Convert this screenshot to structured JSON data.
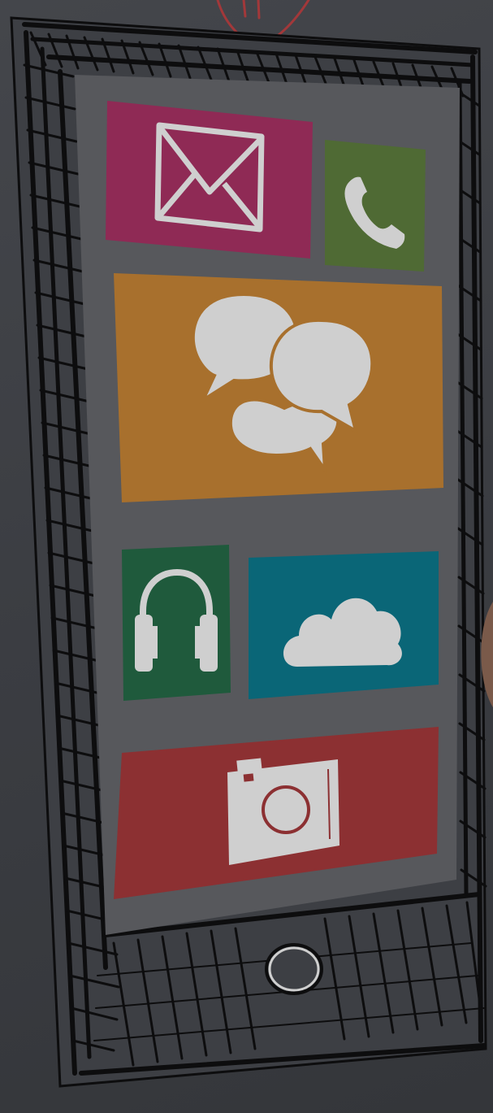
{
  "colors": {
    "background": "#3b3d42",
    "screen": "#57585c",
    "frame_ink": "#0d0d0e",
    "mail_tile": "#8f2a55",
    "phone_tile": "#4f6a34",
    "chat_tile": "#a8702d",
    "music_tile": "#1f5a3c",
    "cloud_tile": "#0a6677",
    "camera_tile": "#8c3032",
    "icon_fill": "#cfcfcf",
    "antenna_mark": "#a2383a",
    "hand": "#7a5a4a"
  },
  "tiles": [
    {
      "id": "mail",
      "icon": "envelope-icon"
    },
    {
      "id": "phone",
      "icon": "phone-handset-icon"
    },
    {
      "id": "chat",
      "icon": "speech-bubbles-icon"
    },
    {
      "id": "music",
      "icon": "headphones-icon"
    },
    {
      "id": "cloud",
      "icon": "cloud-icon"
    },
    {
      "id": "camera",
      "icon": "camera-icon"
    }
  ],
  "home_button": {
    "icon": "home-button-icon"
  }
}
